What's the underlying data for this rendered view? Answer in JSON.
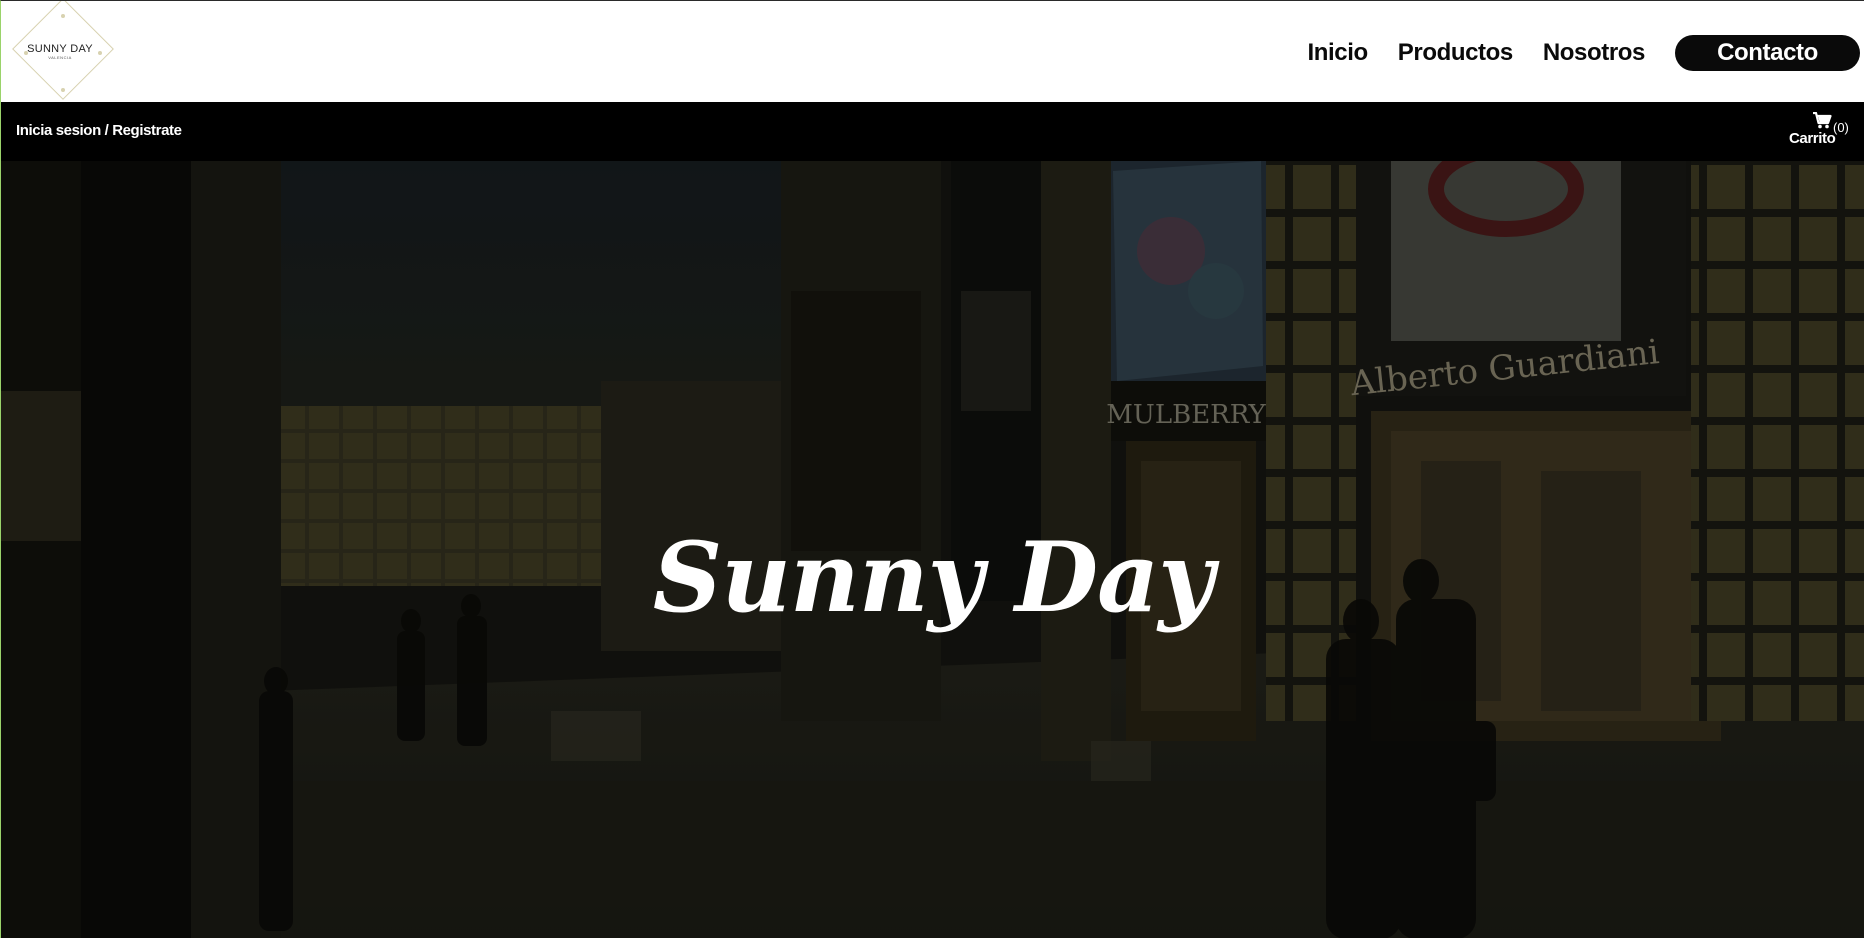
{
  "brand": {
    "logo_title": "SUNNY DAY",
    "logo_subtitle": "VALENCIA"
  },
  "nav": {
    "items": [
      "Inicio",
      "Productos",
      "Nosotros"
    ],
    "contact_label": "Contacto"
  },
  "userbar": {
    "login_label": "Inicia sesion",
    "separator": "/",
    "register_label": "Registrate",
    "cart_label": "Carrito",
    "cart_count": "(0)",
    "cart_icon": "shopping-cart-icon"
  },
  "hero": {
    "title": "Sunny Day",
    "sign_mulberry": "MULBERRY",
    "sign_guardiani": "Alberto Guardiani"
  },
  "colors": {
    "navbar_bg": "#ffffff",
    "userbar_bg": "#000000",
    "contact_bg": "#0a0a0a",
    "hero_overlay": "#14140f"
  }
}
